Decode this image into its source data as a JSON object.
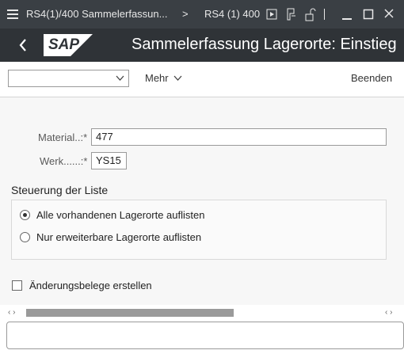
{
  "titlebar": {
    "tab1": "RS4(1)/400 Sammelerfassun...",
    "separator": ">",
    "tab2": "RS4 (1) 400"
  },
  "header": {
    "back_icon": "chevron-left-icon",
    "logo": "SAP",
    "title": "Sammelerfassung Lagerorte: Einstieg"
  },
  "toolbar": {
    "dropdown_value": "",
    "more_label": "Mehr",
    "exit_label": "Beenden"
  },
  "form": {
    "material_label": "Material..:",
    "material_value": "477",
    "plant_label": "Werk......:",
    "plant_value": "YS15",
    "required_marker": "*"
  },
  "list_control": {
    "title": "Steuerung der Liste",
    "options": [
      {
        "label": "Alle vorhandenen Lagerorte auflisten",
        "selected": true
      },
      {
        "label": "Nur erweiterbare Lagerorte auflisten",
        "selected": false
      }
    ]
  },
  "checkbox": {
    "label": "Änderungsbelege erstellen",
    "checked": false
  },
  "scrollbar": {
    "left_arrows": "‹ ›",
    "right_arrows": "‹ ›"
  }
}
